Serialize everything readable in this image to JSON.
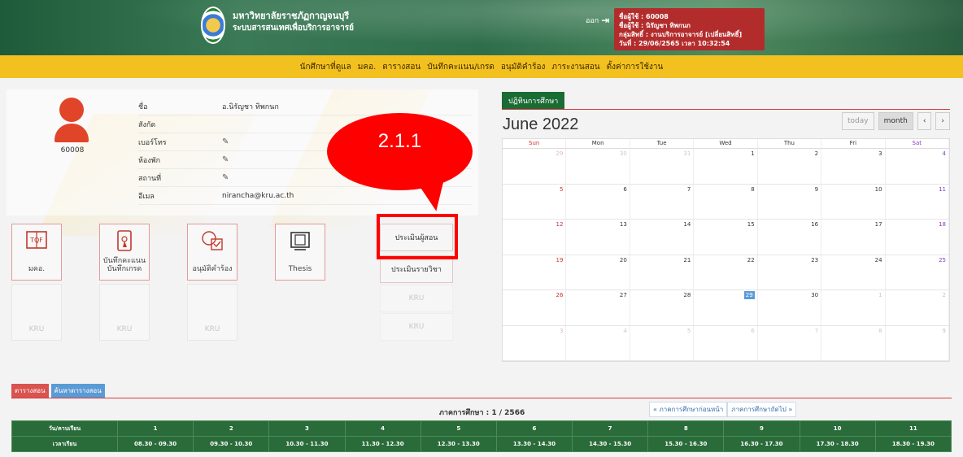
{
  "header": {
    "university": "มหาวิทยาลัยราชภัฏกาญจนบุรี",
    "system": "ระบบสารสนเทศเพื่อบริการอาจารย์",
    "logout": "ออก",
    "user": {
      "line1": "ชื่อผู้ใช้ : 60008",
      "line2": "ชื่อผู้ใช้ : นิรัญชา ทิพกนก",
      "line3": "กลุ่มสิทธิ์ : งานบริการอาจารย์ [เปลี่ยนสิทธิ์]",
      "line4": "วันที่ : 29/06/2565 เวลา 10:32:54"
    }
  },
  "nav": [
    "นักศึกษาที่ดูแล",
    "มคอ.",
    "ตารางสอน",
    "บันทึกคะแนน/เกรด",
    "อนุมัติคำร้อง",
    "ภาระงานสอน",
    "ตั้งค่าการใช้งาน"
  ],
  "profile": {
    "id": "60008",
    "rows": [
      {
        "label": "ชื่อ",
        "value": "อ.นิรัญชา ทิพกนก"
      },
      {
        "label": "สังกัด",
        "value": ""
      },
      {
        "label": "เบอร์โทร",
        "value": ""
      },
      {
        "label": "ห้องพัก",
        "value": ""
      },
      {
        "label": "สถานที่",
        "value": ""
      },
      {
        "label": "อีเมล",
        "value": "nirancha@kru.ac.th"
      }
    ]
  },
  "callout": "2.1.1",
  "tiles": [
    {
      "label": "มคอ.",
      "icon": "tqf-book-icon"
    },
    {
      "label": "บันทึกคะแนน\nบันทึกเกรด",
      "icon": "tablet-touch-icon"
    },
    {
      "label": "อนุมัติคำร้อง",
      "icon": "approve-doc-icon"
    },
    {
      "label": "Thesis",
      "icon": "thesis-book-icon"
    }
  ],
  "empty_label": "KRU",
  "eval_buttons": [
    "ประเมินผู้สอน",
    "ประเมินรายวิชา"
  ],
  "calendar": {
    "tab": "ปฏิทินการศึกษา",
    "title": "June 2022",
    "today_label": "today",
    "month_label": "month",
    "prev": "‹",
    "next": "›",
    "weekdays": [
      "Sun",
      "Mon",
      "Tue",
      "Wed",
      "Thu",
      "Fri",
      "Sat"
    ],
    "weeks": [
      [
        "29",
        "30",
        "31",
        "1",
        "2",
        "3",
        "4"
      ],
      [
        "5",
        "6",
        "7",
        "8",
        "9",
        "10",
        "11"
      ],
      [
        "12",
        "13",
        "14",
        "15",
        "16",
        "17",
        "18"
      ],
      [
        "19",
        "20",
        "21",
        "22",
        "23",
        "24",
        "25"
      ],
      [
        "26",
        "27",
        "28",
        "29",
        "30",
        "1",
        "2"
      ],
      [
        "3",
        "4",
        "5",
        "6",
        "7",
        "8",
        "9"
      ]
    ],
    "today_value": "29"
  },
  "schedule": {
    "tabs": [
      "ตารางสอน",
      "ค้นหาตารางสอน"
    ],
    "term": "ภาคการศึกษา : 1 / 2566",
    "prev_term": "« ภาคการศึกษาก่อนหน้า",
    "next_term": "ภาคการศึกษาถัดไป »",
    "row1": [
      "วัน/คาบเรียน",
      "1",
      "2",
      "3",
      "4",
      "5",
      "6",
      "7",
      "8",
      "9",
      "10",
      "11"
    ],
    "row2": [
      "เวลาเรียน",
      "08.30 - 09.30",
      "09.30 - 10.30",
      "10.30 - 11.30",
      "11.30 - 12.30",
      "12.30 - 13.30",
      "13.30 - 14.30",
      "14.30 - 15.30",
      "15.30 - 16.30",
      "16.30 - 17.30",
      "17.30 - 18.30",
      "18.30 - 19.30"
    ]
  },
  "colors": {
    "accent": "#f3c11f",
    "brand_green": "#1a6b34",
    "alert_red": "#ff0000"
  }
}
